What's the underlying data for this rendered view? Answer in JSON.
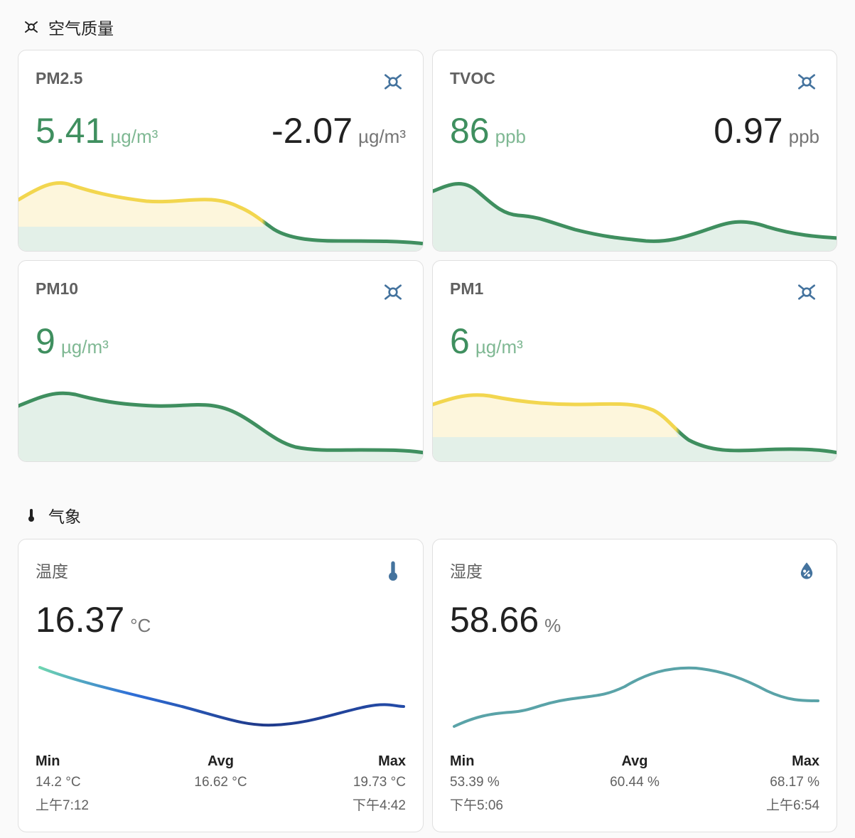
{
  "sections": {
    "air": {
      "title": "空气质量",
      "icon": "air-filter-icon"
    },
    "weather": {
      "title": "气象",
      "icon": "thermometer-icon"
    }
  },
  "cards": {
    "pm25": {
      "name": "PM2.5",
      "value": "5.41",
      "unit": "µg/m³",
      "delta": "-2.07",
      "delta_unit": "µg/m³",
      "icon": "air-filter-icon"
    },
    "tvoc": {
      "name": "TVOC",
      "value": "86",
      "unit": "ppb",
      "delta": "0.97",
      "delta_unit": "ppb",
      "icon": "air-filter-icon"
    },
    "pm10": {
      "name": "PM10",
      "value": "9",
      "unit": "µg/m³",
      "icon": "air-filter-icon"
    },
    "pm1": {
      "name": "PM1",
      "value": "6",
      "unit": "µg/m³",
      "icon": "air-filter-icon"
    },
    "temperature": {
      "name": "温度",
      "value": "16.37",
      "unit": "°C",
      "icon": "thermometer-icon",
      "min_label": "Min",
      "avg_label": "Avg",
      "max_label": "Max",
      "min": "14.2 °C",
      "avg": "16.62 °C",
      "max": "19.73 °C",
      "min_time": "上午7:12",
      "max_time": "下午4:42"
    },
    "humidity": {
      "name": "湿度",
      "value": "58.66",
      "unit": "%",
      "icon": "water-percent-icon",
      "min_label": "Min",
      "avg_label": "Avg",
      "max_label": "Max",
      "min": "53.39 %",
      "avg": "60.44 %",
      "max": "68.17 %",
      "min_time": "下午5:06",
      "max_time": "上午6:54"
    }
  },
  "colors": {
    "good": "#3f8f5f",
    "moderate": "#f2d64f",
    "icon": "#44739e",
    "humidity_line": "#5aa3a8"
  }
}
